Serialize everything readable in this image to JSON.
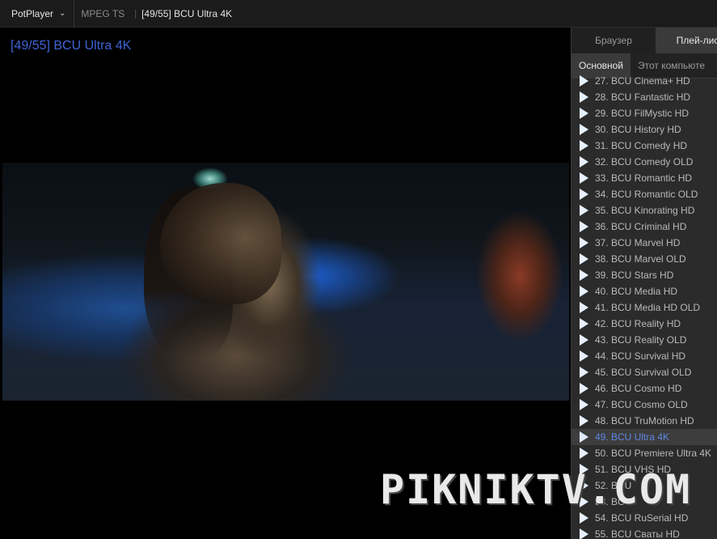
{
  "titlebar": {
    "app_name": "PotPlayer",
    "format": "MPEG TS",
    "separator": "|",
    "title": "[49/55] BCU Ultra 4K"
  },
  "video": {
    "osd_text": "[49/55] BCU Ultra 4K",
    "watermark": "PIKNIKTV.COM"
  },
  "panel": {
    "tabs": [
      "Браузер",
      "Плей-лис"
    ],
    "active_tab": 1,
    "subtabs": [
      "Основной",
      "Этот компьюте"
    ],
    "active_subtab": 0,
    "playlist": [
      "27. BCU Cinema+ HD",
      "28. BCU Fantastic HD",
      "29. BCU FilMystic HD",
      "30. BCU History HD",
      "31. BCU Comedy HD",
      "32. BCU Comedy OLD",
      "33. BCU Romantic HD",
      "34. BCU Romantic OLD",
      "35. BCU Kinorating HD",
      "36. BCU Criminal HD",
      "37. BCU Marvel HD",
      "38. BCU Marvel OLD",
      "39. BCU Stars HD",
      "40. BCU Media HD",
      "41. BCU Media HD OLD",
      "42. BCU Reality HD",
      "43. BCU Reality OLD",
      "44. BCU Survival HD",
      "45. BCU Survival OLD",
      "46. BCU Cosmo HD",
      "47. BCU Cosmo OLD",
      "48. BCU TruMotion HD",
      "49. BCU Ultra 4K",
      "50. BCU Premiere Ultra 4K",
      "51. BCU VHS HD",
      "52. BCU",
      "53. BCU",
      "54. BCU RuSerial HD",
      "55. BCU Сваты HD"
    ],
    "active_index": 22
  },
  "colors": {
    "accent_blue": "#3f63d8",
    "active_item_text": "#5f86e6"
  }
}
